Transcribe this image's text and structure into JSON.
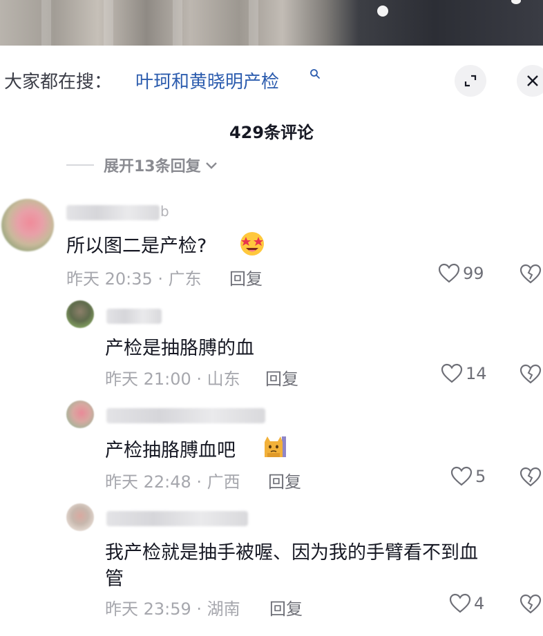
{
  "search": {
    "prefix": "大家都在搜：",
    "term": "叶珂和黄晓明产检",
    "term_icon": "search-icon"
  },
  "header": {
    "title": "429条评论"
  },
  "expand": {
    "label": "展开13条回复"
  },
  "comments": [
    {
      "name_suffix": "b",
      "text": "所以图二是产检?",
      "emoji": "star-struck-emoji",
      "time_loc": "昨天 20:35 · 广东",
      "reply": "回复",
      "likes": "99"
    },
    {
      "name_suffix": "",
      "text": "产检是抽胳膊的血",
      "time_loc": "昨天 21:00 · 山东",
      "reply": "回复",
      "likes": "14"
    },
    {
      "name_suffix": "",
      "text": "产检抽胳膊血吧",
      "emoji": "cat-emoji",
      "time_loc": "昨天 22:48 · 广西",
      "reply": "回复",
      "likes": "5"
    },
    {
      "name_suffix": "",
      "text_line1": "我产检就是抽手被喔、因为我的手臂看不到血",
      "text_line2": "管",
      "time_loc": "昨天 23:59 · 湖南",
      "reply": "回复",
      "likes": "4"
    }
  ],
  "icons": {
    "expand": "expand-icon",
    "close": "close-icon",
    "like": "heart-icon",
    "dislike": "broken-heart-icon",
    "chevron": "chevron-down-icon"
  },
  "colors": {
    "link_blue": "#2c5cae",
    "meta_gray": "#a6a7ad",
    "text": "#161823"
  }
}
